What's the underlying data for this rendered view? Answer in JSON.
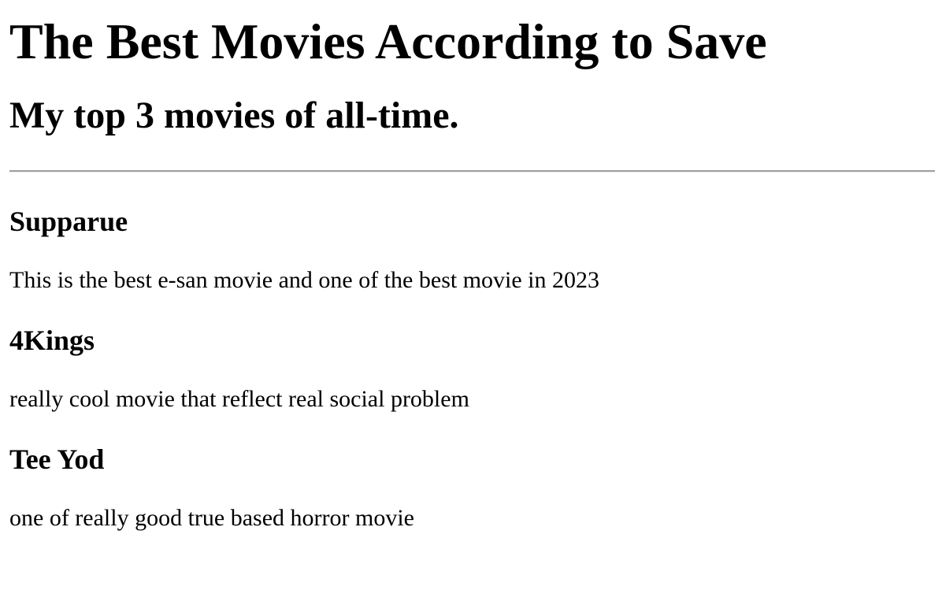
{
  "page": {
    "title": "The Best Movies According to Save",
    "subtitle": "My top 3 movies of all-time."
  },
  "movies": [
    {
      "name": "Supparue",
      "description": "This is the best e-san movie and one of the best movie in 2023"
    },
    {
      "name": "4Kings",
      "description": "really cool movie that reflect real social problem"
    },
    {
      "name": "Tee Yod",
      "description": "one of really good true based horror movie"
    }
  ]
}
